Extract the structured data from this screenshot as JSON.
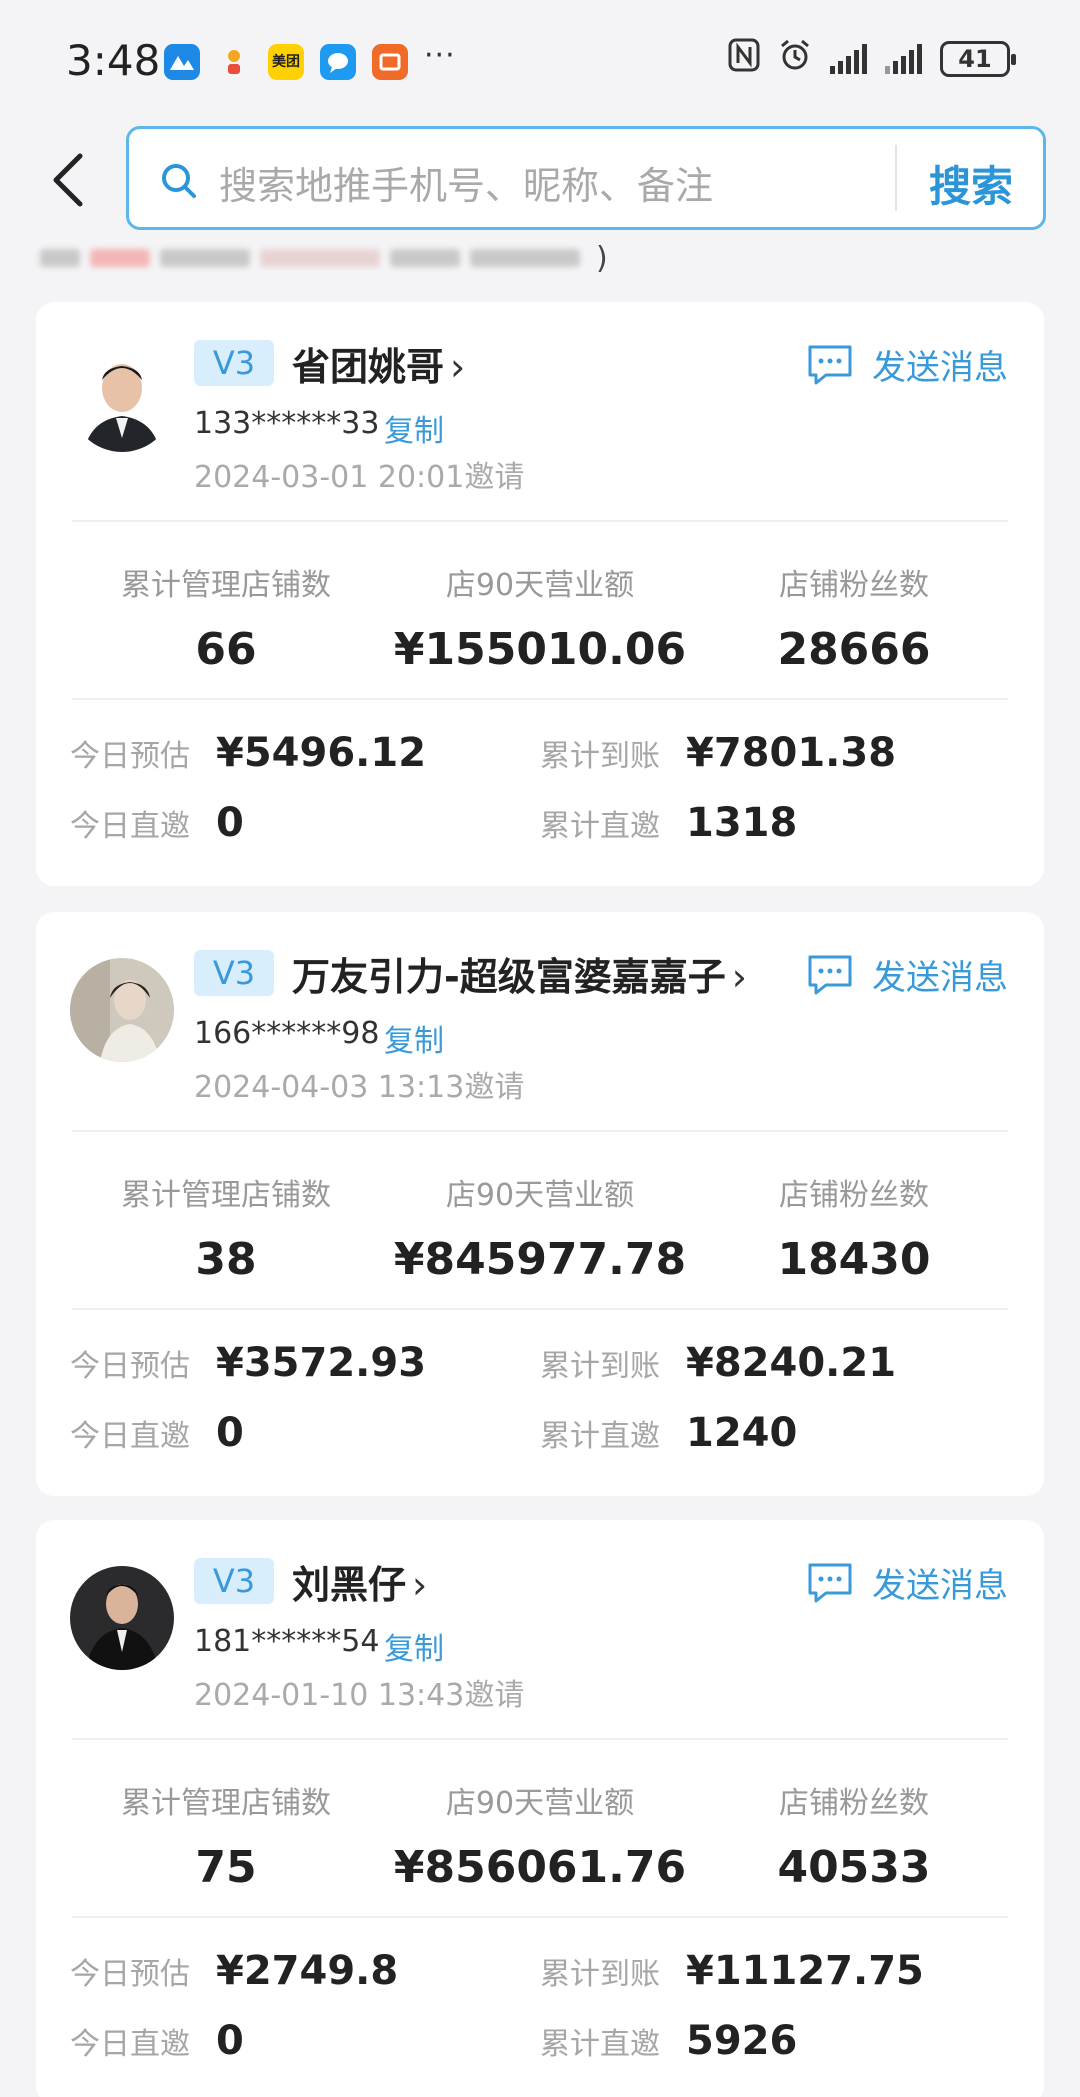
{
  "status_bar": {
    "time": "3:48",
    "notification_icons": [
      "app-icon",
      "app-icon",
      "美团",
      "chat-icon",
      "app-icon"
    ],
    "more": "···",
    "battery": "41"
  },
  "search": {
    "placeholder": "搜索地推手机号、昵称、备注",
    "button_label": "搜索"
  },
  "filter_tail": ")",
  "cards": [
    {
      "level": "V3",
      "nickname": "省团姚哥",
      "send_label": "发送消息",
      "phone": "133******33",
      "copy_label": "复制",
      "invite": "2024-03-01 20:01邀请",
      "stats": [
        {
          "label": "累计管理店铺数",
          "value": "66"
        },
        {
          "label": "店90天营业额",
          "value": "¥155010.06"
        },
        {
          "label": "店铺粉丝数",
          "value": "28666"
        }
      ],
      "today_est_label": "今日预估",
      "today_est": "¥5496.12",
      "total_recv_label": "累计到账",
      "total_recv": "¥7801.38",
      "today_inv_label": "今日直邀",
      "today_inv": "0",
      "total_inv_label": "累计直邀",
      "total_inv": "1318"
    },
    {
      "level": "V3",
      "nickname": "万友引力-超级富婆嘉嘉子",
      "send_label": "发送消息",
      "phone": "166******98",
      "copy_label": "复制",
      "invite": "2024-04-03 13:13邀请",
      "stats": [
        {
          "label": "累计管理店铺数",
          "value": "38"
        },
        {
          "label": "店90天营业额",
          "value": "¥845977.78"
        },
        {
          "label": "店铺粉丝数",
          "value": "18430"
        }
      ],
      "today_est_label": "今日预估",
      "today_est": "¥3572.93",
      "total_recv_label": "累计到账",
      "total_recv": "¥8240.21",
      "today_inv_label": "今日直邀",
      "today_inv": "0",
      "total_inv_label": "累计直邀",
      "total_inv": "1240"
    },
    {
      "level": "V3",
      "nickname": "刘黑仔",
      "send_label": "发送消息",
      "phone": "181******54",
      "copy_label": "复制",
      "invite": "2024-01-10 13:43邀请",
      "stats": [
        {
          "label": "累计管理店铺数",
          "value": "75"
        },
        {
          "label": "店90天营业额",
          "value": "¥856061.76"
        },
        {
          "label": "店铺粉丝数",
          "value": "40533"
        }
      ],
      "today_est_label": "今日预估",
      "today_est": "¥2749.8",
      "total_recv_label": "累计到账",
      "total_recv": "¥11127.75",
      "today_inv_label": "今日直邀",
      "today_inv": "0",
      "total_inv_label": "累计直邀",
      "total_inv": "5926"
    }
  ],
  "colors": {
    "accent": "#2b95d8",
    "badge_bg": "#d8eefc",
    "background": "#f4f4f6"
  }
}
